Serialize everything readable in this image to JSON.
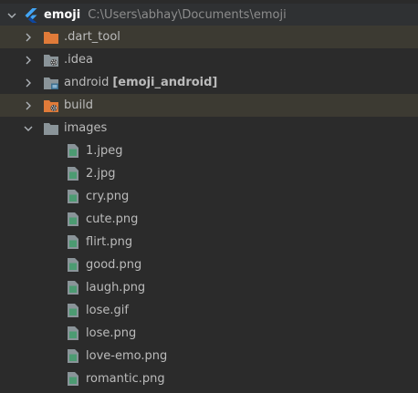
{
  "colors": {
    "background": "#2b2b2b",
    "excluded_row": "#3c3a32",
    "folder_grey": "#8a9499",
    "folder_orange": "#e07b39",
    "file_green": "#4c9b72",
    "text": "#bbbbbb",
    "muted": "#8c8c8c",
    "flutter_blue": "#42a5f5"
  },
  "root": {
    "name": "emoji",
    "path": "C:\\Users\\abhay\\Documents\\emoji",
    "icon": "flutter-icon",
    "expanded": true
  },
  "top_folders": [
    {
      "name": ".dart_tool",
      "icon": "excluded-folder-icon",
      "excluded": true,
      "expanded": false
    },
    {
      "name": ".idea",
      "icon": "settings-folder-icon",
      "excluded": false,
      "expanded": false
    },
    {
      "name": "android",
      "module": "[emoji_android]",
      "icon": "module-folder-icon",
      "excluded": false,
      "expanded": false
    },
    {
      "name": "build",
      "icon": "excluded-settings-folder-icon",
      "excluded": true,
      "expanded": false
    }
  ],
  "images_folder": {
    "name": "images",
    "icon": "folder-icon",
    "expanded": true,
    "files": [
      {
        "name": "1.jpeg",
        "icon": "image-file-icon"
      },
      {
        "name": "2.jpg",
        "icon": "image-file-icon"
      },
      {
        "name": "cry.png",
        "icon": "image-file-icon"
      },
      {
        "name": "cute.png",
        "icon": "image-file-icon"
      },
      {
        "name": "flirt.png",
        "icon": "image-file-icon"
      },
      {
        "name": "good.png",
        "icon": "image-file-icon"
      },
      {
        "name": "laugh.png",
        "icon": "image-file-icon"
      },
      {
        "name": "lose.gif",
        "icon": "image-file-icon"
      },
      {
        "name": "lose.png",
        "icon": "image-file-icon"
      },
      {
        "name": "love-emo.png",
        "icon": "image-file-icon"
      },
      {
        "name": "romantic.png",
        "icon": "image-file-icon"
      }
    ]
  }
}
